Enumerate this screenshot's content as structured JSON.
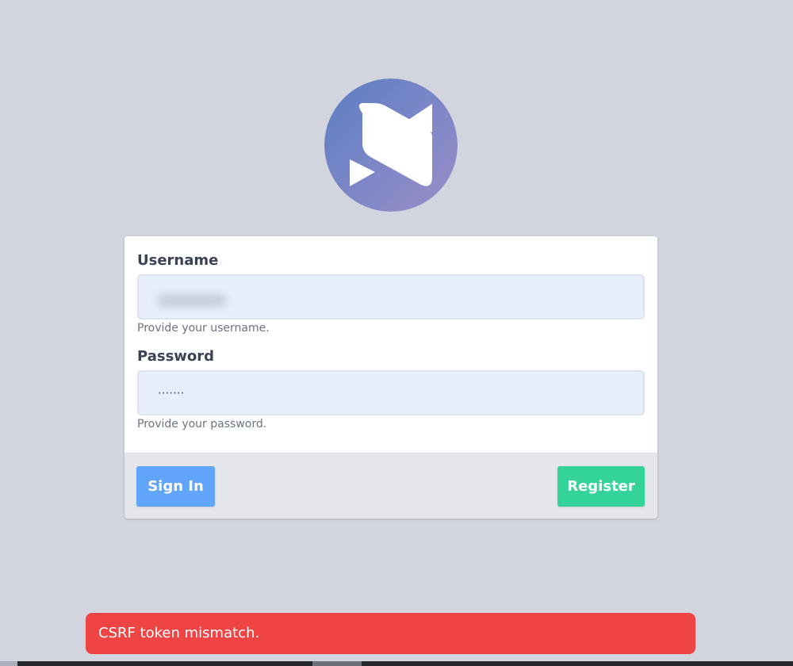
{
  "colors": {
    "page_bg": "#d2d5de",
    "logo_gradient_start": "#5b7ec4",
    "logo_gradient_end": "#9b8ec8",
    "signin_button": "#60a5fa",
    "register_button": "#34d399",
    "toast_error": "#ef4444",
    "input_bg": "#e8effc"
  },
  "logo": {
    "icon": "brand-logo-icon"
  },
  "form": {
    "username": {
      "label": "Username",
      "value": "",
      "help": "Provide your username."
    },
    "password": {
      "label": "Password",
      "value": "·······",
      "help": "Provide your password."
    }
  },
  "footer": {
    "signin_label": "Sign In",
    "register_label": "Register"
  },
  "toast": {
    "message": "CSRF token mismatch."
  }
}
